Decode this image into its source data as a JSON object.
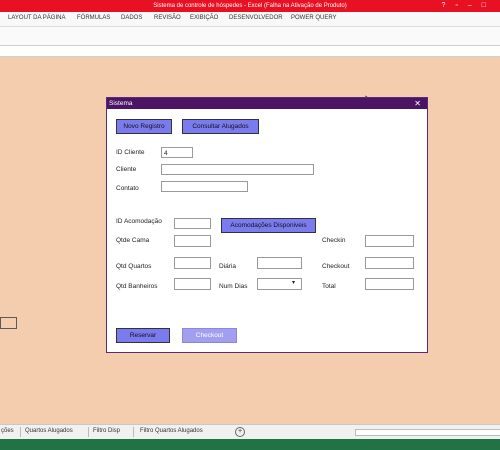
{
  "window": {
    "title": "Sistema de controle de hóspedes - Excel (Falha na Ativação de Produto)"
  },
  "ribbon": {
    "tabs": [
      "LAYOUT DA PÁGINA",
      "FÓRMULAS",
      "DADOS",
      "REVISÃO",
      "EXIBIÇÃO",
      "DESENVOLVEDOR",
      "POWER QUERY"
    ]
  },
  "sheets": [
    "ções",
    "Quartos Alugados",
    "Filtro Disp",
    "Filtro Quartos Alugados"
  ],
  "dialog": {
    "title": "Sistema",
    "buttons": {
      "novo_registro": "Novo Registro",
      "consultar_alugados": "Consultar Alugados",
      "acomodacoes_disponiveis": "Acomodações Disponiveis",
      "reservar": "Reservar",
      "checkout": "Checkout"
    },
    "labels": {
      "id_cliente": "ID Cliente",
      "cliente": "Cliente",
      "contato": "Contato",
      "id_acomodacao": "ID Acomodação",
      "qtde_cama": "Qtde Cama",
      "qtd_quartos": "Qtd Quartos",
      "qtd_banheiros": "Qtd Banheiros",
      "diaria": "Diária",
      "num_dias": "Num Dias",
      "checkin": "Checkin",
      "checkout": "Checkout",
      "total": "Total"
    },
    "fields": {
      "id_cliente": "4",
      "cliente": "",
      "contato": "",
      "id_acomodacao": "",
      "qtde_cama": "",
      "qtd_quartos": "",
      "qtd_banheiros": "",
      "diaria": "",
      "num_dias": "",
      "checkin": "",
      "checkout": "",
      "total": ""
    }
  },
  "colors": {
    "titlebar": "#e81123",
    "dialog_title": "#4b1465",
    "button": "#7b7bf0",
    "background": "#f4cdae",
    "status": "#217346"
  }
}
